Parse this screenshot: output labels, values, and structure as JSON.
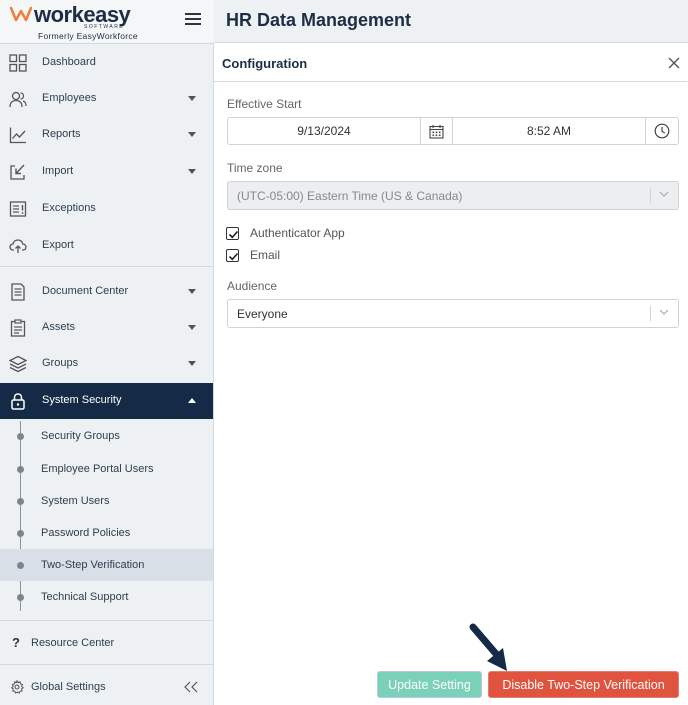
{
  "brand": {
    "wordmark": "workeasy",
    "sub": "SOFTWARE",
    "former": "Formerly EasyWorkforce",
    "accent_color": "#f07d3a",
    "navy_color": "#152a46"
  },
  "sidebar": {
    "menu_icon": "hamburger-icon",
    "items": [
      {
        "label": "Dashboard",
        "icon": "grid-icon"
      },
      {
        "label": "Employees",
        "icon": "users-icon"
      },
      {
        "label": "Reports",
        "icon": "chart-icon"
      },
      {
        "label": "Import",
        "icon": "import-icon"
      },
      {
        "label": "Exceptions",
        "icon": "exceptions-icon"
      },
      {
        "label": "Export",
        "icon": "cloud-upload-icon"
      },
      {
        "label": "Document Center",
        "icon": "document-icon"
      },
      {
        "label": "Assets",
        "icon": "clipboard-icon"
      },
      {
        "label": "Groups",
        "icon": "layers-icon"
      },
      {
        "label": "System Security",
        "icon": "lock-icon"
      }
    ],
    "security_sub": [
      {
        "label": "Security Groups"
      },
      {
        "label": "Employee Portal Users"
      },
      {
        "label": "System Users"
      },
      {
        "label": "Password Policies"
      },
      {
        "label": "Two-Step Verification"
      },
      {
        "label": "Technical Support"
      }
    ],
    "resource_center": {
      "label": "Resource Center",
      "icon": "question-icon"
    },
    "global_settings": {
      "label": "Global Settings",
      "icon": "gear-icon"
    },
    "collapse_icon": "double-chevron-left-icon"
  },
  "header": {
    "title": "HR Data Management"
  },
  "panel": {
    "title": "Configuration",
    "close_icon": "close-icon",
    "effective_start": {
      "label": "Effective Start",
      "date": "9/13/2024",
      "time": "8:52 AM",
      "calendar_icon": "calendar-icon",
      "clock_icon": "clock-icon"
    },
    "timezone": {
      "label": "Time zone",
      "value": "(UTC-05:00) Eastern Time (US & Canada)",
      "disabled": true
    },
    "methods": [
      {
        "label": "Authenticator App",
        "checked": true
      },
      {
        "label": "Email",
        "checked": true
      }
    ],
    "audience": {
      "label": "Audience",
      "value": "Everyone"
    },
    "buttons": {
      "update": "Update Setting",
      "disable": "Disable Two-Step Verification"
    }
  }
}
